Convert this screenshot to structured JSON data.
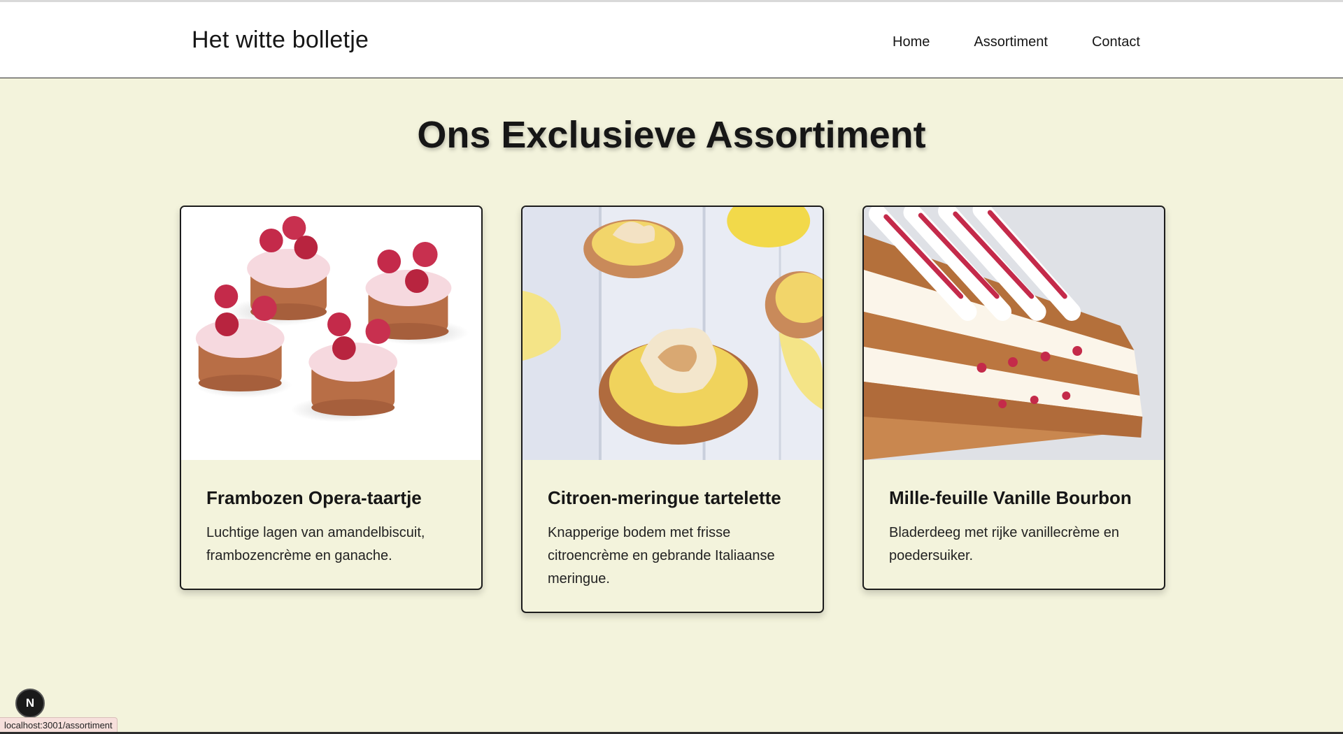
{
  "brand": "Het witte bolletje",
  "nav": {
    "home": "Home",
    "assortiment": "Assortiment",
    "contact": "Contact"
  },
  "page_title": "Ons Exclusieve Assortiment",
  "products": [
    {
      "title": "Frambozen Opera-taartje",
      "description": "Luchtige lagen van amandelbiscuit, frambozencrème en ganache."
    },
    {
      "title": "Citroen-meringue tartelette",
      "description": "Knapperige bodem met frisse citroencrème en gebrande Italiaanse meringue."
    },
    {
      "title": "Mille-feuille Vanille Bourbon",
      "description": "Bladerdeeg met rijke vanillecrème en poedersuiker."
    }
  ],
  "status_url": "localhost:3001/assortiment",
  "dev_badge": "N",
  "colors": {
    "background": "#f3f3dc",
    "header": "#ffffff",
    "text": "#161616",
    "raspberry": "#c42a4a",
    "lemon": "#f4dc6a",
    "pastry": "#c87a4a"
  }
}
